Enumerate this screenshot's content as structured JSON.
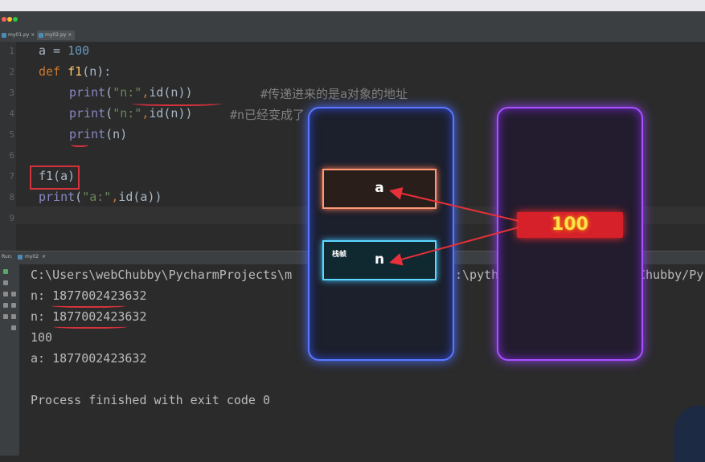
{
  "tabs": [
    {
      "label": "my01.py",
      "close": "×"
    },
    {
      "label": "my02.py",
      "close": "×"
    }
  ],
  "editor": {
    "line_numbers": [
      "1",
      "2",
      "3",
      "4",
      "5",
      "6",
      "7",
      "8",
      "9"
    ],
    "line1": {
      "a": "a",
      "eq": " = ",
      "num": "100"
    },
    "line2": {
      "kw": "def ",
      "fn": "f1",
      "rest": "(n):"
    },
    "line3": {
      "builtin": "print",
      "open": "(",
      "str": "\"n:\"",
      "comma": ",",
      "id": "id",
      "rest": "(n))",
      "comment": "#传递进来的是a对象的地址"
    },
    "line4": {
      "builtin": "print",
      "open": "(",
      "str": "\"n:\"",
      "comma": ",",
      "id": "id",
      "rest": "(n))",
      "comment": "#n已经变成了"
    },
    "line5": {
      "builtin": "print",
      "rest": "(n)"
    },
    "line7": {
      "text": "f1(a)"
    },
    "line8": {
      "builtin": "print",
      "open": "(",
      "str": "\"a:\"",
      "comma": ",",
      "id": "id",
      "rest": "(a))"
    }
  },
  "run_panel": {
    "label": "Run:",
    "tab": "my02",
    "close": "×"
  },
  "console": {
    "lines": [
      "C:\\Users\\webChubby\\PycharmProjects\\m",
      "n: 1877002423632",
      "n: 1877002423632",
      "100",
      "a: 1877002423632",
      "",
      "Process finished with exit code 0"
    ],
    "frag_python": ":\\pytho",
    "frag_chubby": "Chubby/Py"
  },
  "diagram": {
    "slot_a_label": "a",
    "slot_n_label": "n",
    "stack_label": "栈帧",
    "value": "100"
  },
  "colors": {
    "stack_card": "#5a78ff",
    "heap_card": "#a950ff",
    "value_box": "#d6202a",
    "value_text": "#ffe14a",
    "annotation_red": "#d8323c"
  }
}
